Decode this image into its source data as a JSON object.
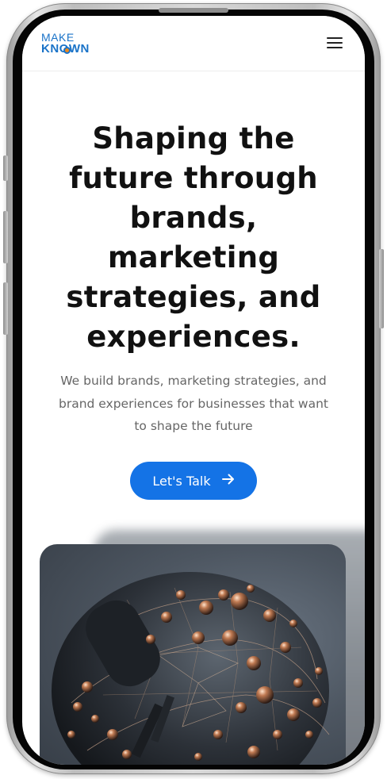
{
  "header": {
    "logo_line1": "MAKE",
    "logo_line2": "KNOWN",
    "menu_icon": "hamburger-menu-icon"
  },
  "hero": {
    "title_lines": [
      "Shaping the",
      "future through",
      "brands,",
      "marketing",
      "strategies, and",
      "experiences."
    ],
    "subtitle_lines": [
      "We build brands, marketing strategies, and",
      "brand experiences for businesses that want",
      "to shape the future"
    ],
    "cta_label": "Let's Talk",
    "cta_icon": "arrow-right-icon"
  },
  "colors": {
    "accent": "#1473e6",
    "logo_blue": "#1a73c8",
    "logo_orange": "#f08a1c",
    "title": "#111111",
    "subtitle": "#666666"
  },
  "media": {
    "hero_image": "abstract-sphere-with-copper-orbs-image"
  }
}
